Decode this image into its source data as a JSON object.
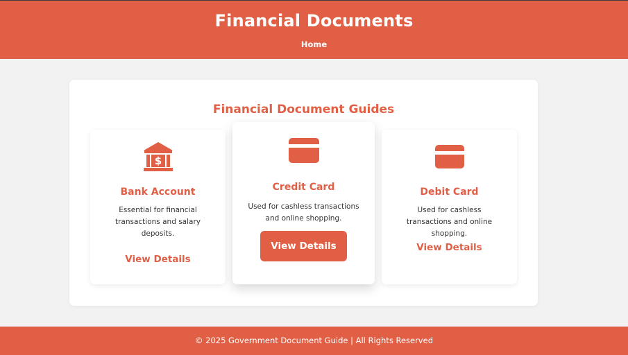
{
  "header": {
    "title": "Financial Documents",
    "nav_home": "Home"
  },
  "section": {
    "title": "Financial Document Guides"
  },
  "cards": [
    {
      "title": "Bank Account",
      "description": "Essential for financial transactions and salary deposits.",
      "action": "View Details",
      "icon": "bank-icon"
    },
    {
      "title": "Credit Card",
      "description": "Used for cashless transactions and online shopping.",
      "action": "View Details",
      "icon": "credit-card-icon"
    },
    {
      "title": "Debit Card",
      "description": "Used for cashless transactions and online shopping.",
      "action": "View Details",
      "icon": "credit-card-icon"
    }
  ],
  "footer": {
    "text": "© 2025 Government Document Guide | All Rights Reserved"
  },
  "colors": {
    "accent": "#e15f45",
    "background": "#f2f2f2"
  }
}
